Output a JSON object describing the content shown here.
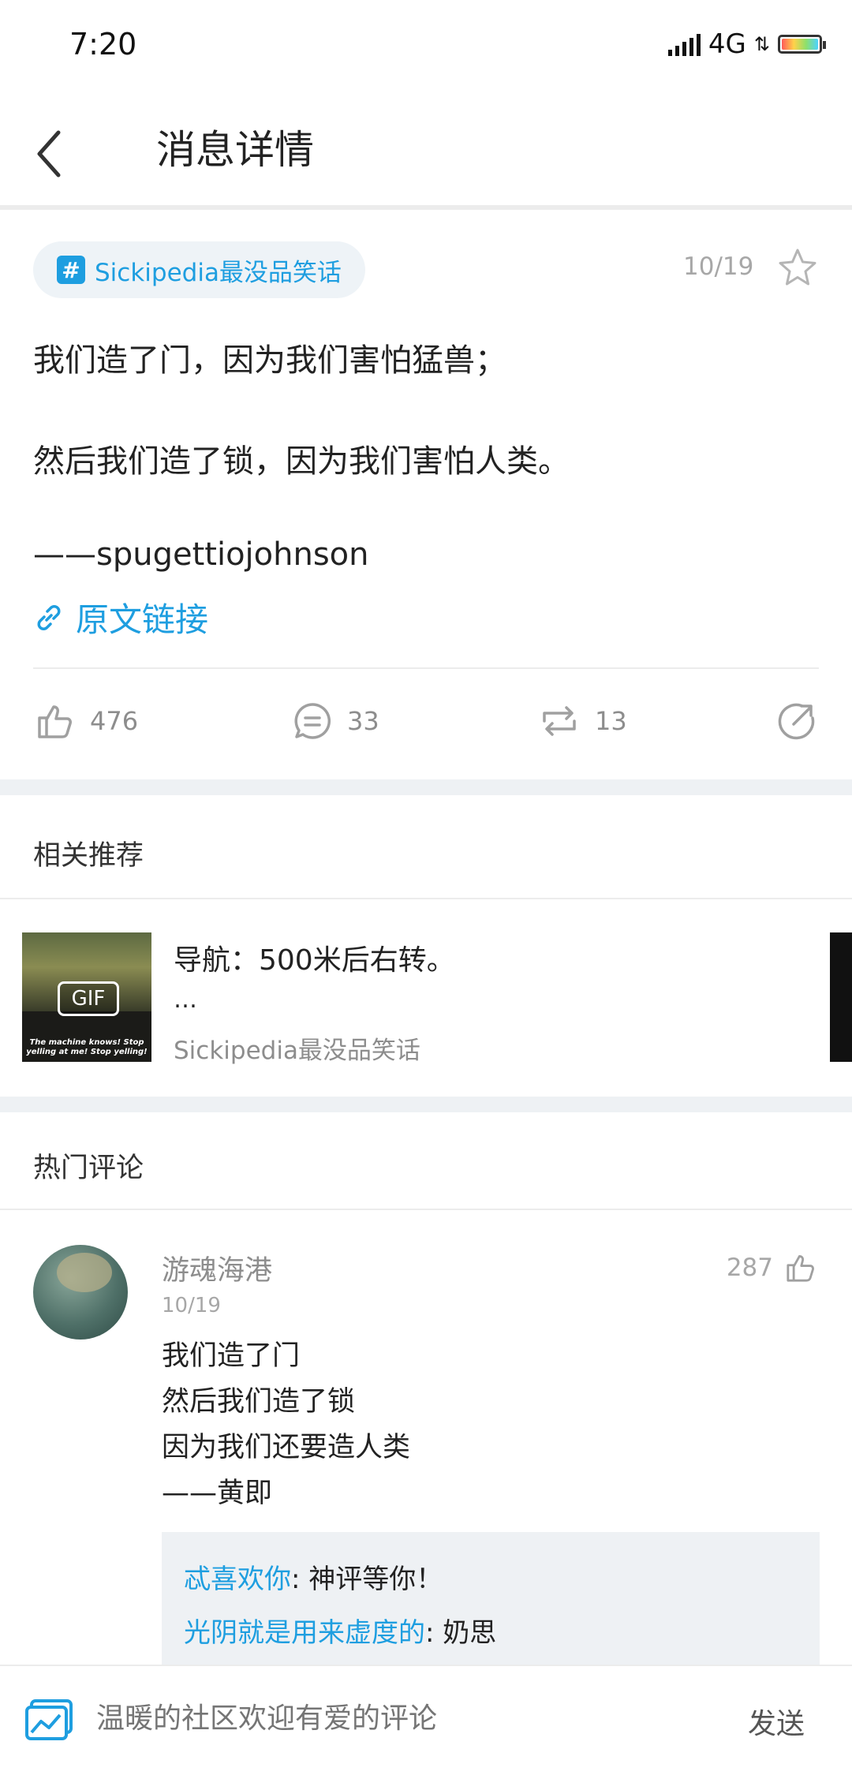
{
  "status_bar": {
    "time": "7:20",
    "network": "4G"
  },
  "header": {
    "title": "消息详情"
  },
  "post": {
    "topic": "Sickipedia最没品笑话",
    "date": "10/19",
    "lines": [
      "我们造了门，因为我们害怕猛兽；",
      "然后我们造了锁，因为我们害怕人类。",
      "——spugettiojohnson"
    ],
    "source_link": "原文链接",
    "likes": "476",
    "comments": "33",
    "reposts": "13"
  },
  "related": {
    "section_title": "相关推荐",
    "item": {
      "title": "导航：500米后右转。",
      "ellipsis": "…",
      "source": "Sickipedia最没品笑话",
      "badge": "GIF",
      "thumb_caption": "The machine knows! Stop yelling at me! Stop yelling!"
    }
  },
  "hot_comments": {
    "section_title": "热门评论",
    "comment": {
      "user": "游魂海港",
      "date": "10/19",
      "likes": "287",
      "lines": [
        "我们造了门",
        "然后我们造了锁",
        "因为我们还要造人类",
        "——黄即"
      ],
      "replies": [
        {
          "user": "忒喜欢你",
          "text": ": 神评等你！"
        },
        {
          "user": "光阴就是用来虚度的",
          "text": ": 奶思"
        }
      ]
    }
  },
  "bottom_bar": {
    "placeholder": "温暖的社区欢迎有爱的评论",
    "send": "发送"
  },
  "colors": {
    "accent": "#1e9ee0",
    "muted": "#8d8d8d",
    "divider": "#ececec",
    "section_bg": "#eef1f4"
  }
}
